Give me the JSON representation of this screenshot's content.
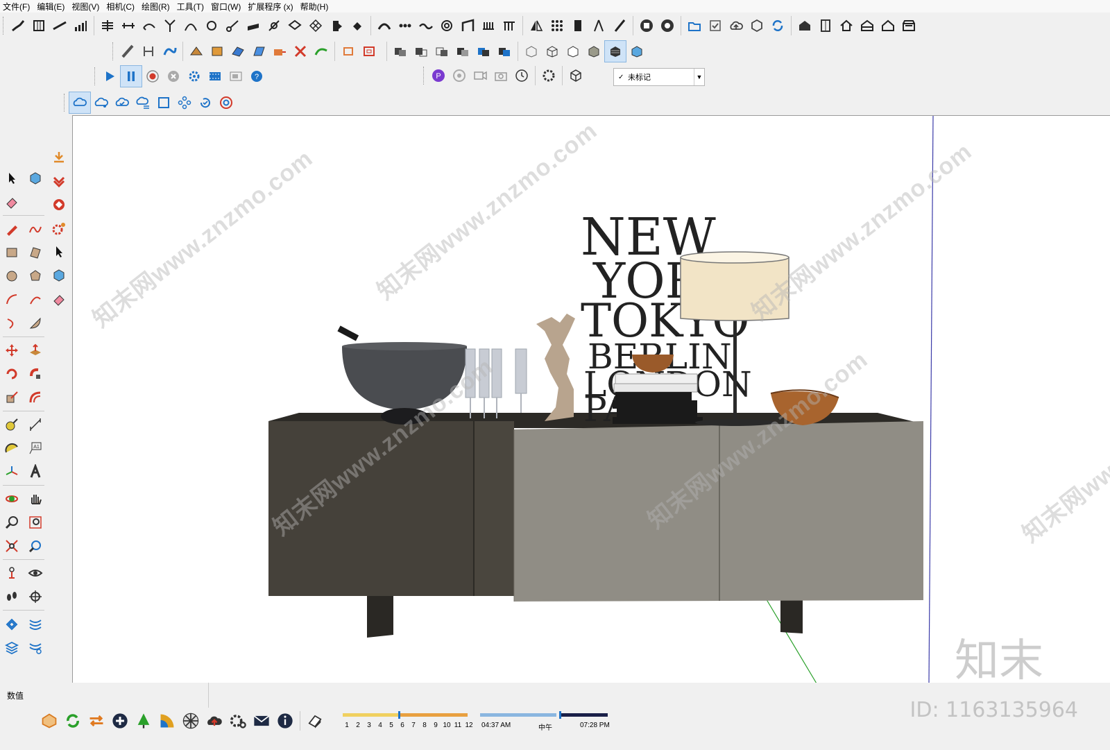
{
  "menu": [
    "文件(F)",
    "编辑(E)",
    "视图(V)",
    "相机(C)",
    "绘图(R)",
    "工具(T)",
    "窗口(W)",
    "扩展程序 (x)",
    "帮助(H)"
  ],
  "tag_dropdown": {
    "value": "未标记"
  },
  "status": {
    "vcb_label": "数值"
  },
  "shadow": {
    "months": [
      "1",
      "2",
      "3",
      "4",
      "5",
      "6",
      "7",
      "8",
      "9",
      "10",
      "11",
      "12"
    ],
    "time_start": "04:37 AM",
    "time_noon": "中午",
    "time_end": "07:28 PM"
  },
  "scene": {
    "poster_lines": [
      "NEW",
      "YORK",
      "TOKYO",
      "BERLIN",
      "LONDON",
      "PARIS"
    ]
  },
  "watermark": {
    "text": "知末网www.znzmo.com",
    "logo": "知末",
    "id": "ID: 1163135964"
  },
  "colors": {
    "viewport_bg": "#ffffff",
    "cabinet_dark": "#45413a",
    "cabinet_light": "#908d85",
    "blue_axis": "#3a3aa8",
    "green_axis": "#2aa02a",
    "accent_blue": "#1e73c8",
    "accent_red": "#d23a2a"
  }
}
